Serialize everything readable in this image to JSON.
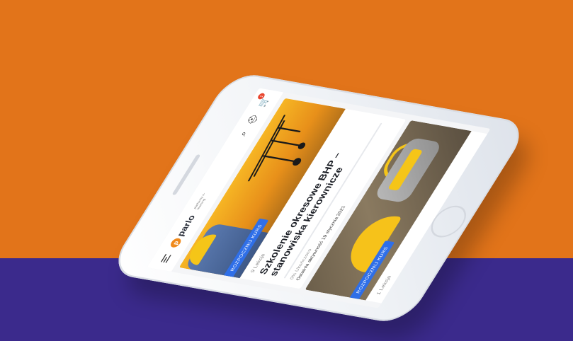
{
  "header": {
    "logo_text": "parlo",
    "logo_mark": "p",
    "logo_sub": "platformy e-learning",
    "icons": [
      "menu-icon",
      "search-icon",
      "user-icon",
      "cart-icon"
    ],
    "cart_count": "1"
  },
  "courses": [
    {
      "badge": "ROZPOCZNIJ KURS",
      "lessons": "9 Lekcje",
      "title": "Szkolenie okresowe BHP – stanowiska kierownicze",
      "completed": "0% Ukończono",
      "last_activity": "Ostatnia aktywność 19 stycznia 2021"
    },
    {
      "badge": "ROZPOCZNIJ KURS",
      "lessons": "1 Lekcja"
    }
  ],
  "colors": {
    "background_top": "#e2741a",
    "background_bottom": "#3b2a8c",
    "badge": "#2f6fe8",
    "brand": "#f08a1c"
  }
}
